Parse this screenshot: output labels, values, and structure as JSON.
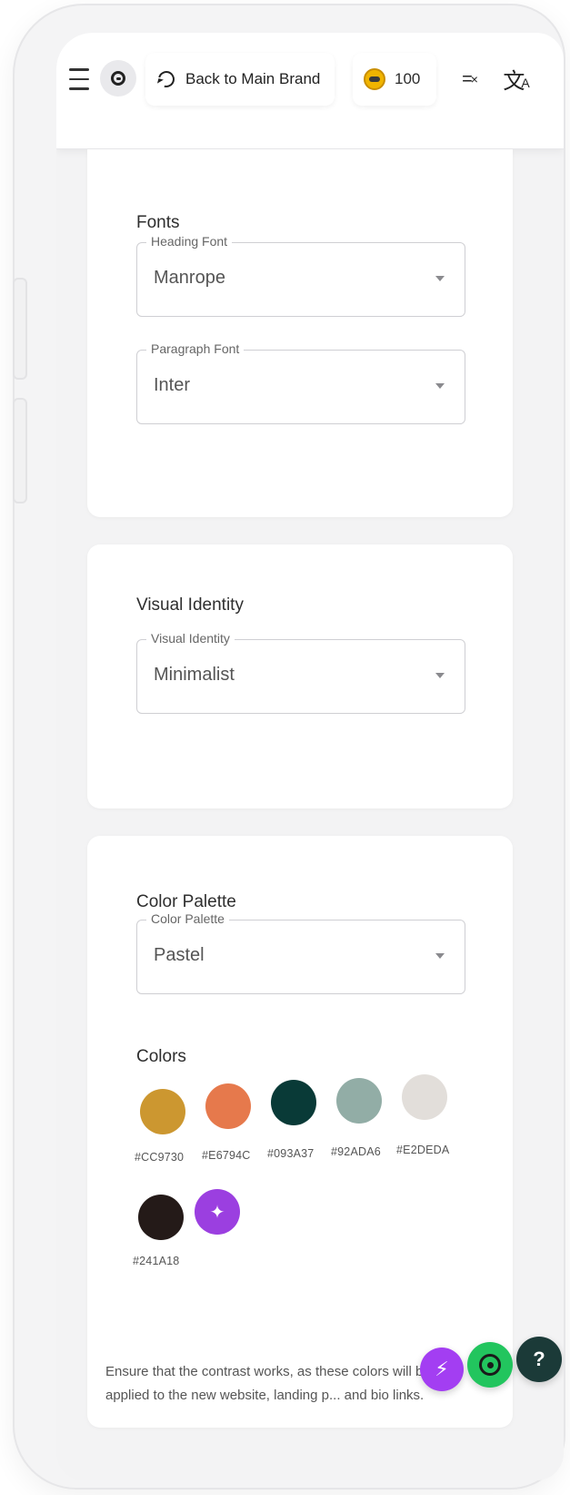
{
  "header": {
    "back_label": "Back to Main Brand",
    "credits": "100"
  },
  "icons": {
    "menu": "hamburger-icon",
    "account": "account-icon",
    "back": "history-back-icon",
    "credits": "coin-icon",
    "sort": "sort-icon",
    "translate": "translate-icon"
  },
  "fonts_section": {
    "title": "Fonts",
    "heading_font": {
      "label": "Heading Font",
      "value": "Manrope"
    },
    "paragraph_font": {
      "label": "Paragraph Font",
      "value": "Inter"
    }
  },
  "visual_section": {
    "title": "Visual Identity",
    "field": {
      "label": "Visual Identity",
      "value": "Minimalist"
    }
  },
  "palette_section": {
    "title": "Color Palette",
    "field": {
      "label": "Color Palette",
      "value": "Pastel"
    },
    "colors_title": "Colors",
    "colors": [
      {
        "hex": "#CC9730",
        "color": "#CC9730"
      },
      {
        "hex": "#E6794C",
        "color": "#E6794C"
      },
      {
        "hex": "#093A37",
        "color": "#093A37"
      },
      {
        "hex": "#92ADA6",
        "color": "#92ADA6"
      },
      {
        "hex": "#E2DEDA",
        "color": "#E2DEDA"
      },
      {
        "hex": "#241A18",
        "color": "#241A18"
      }
    ],
    "magic_icon": "sparkles-icon",
    "note": "Ensure that the contrast works, as these colors will be applied to the new website, landing p... and bio links."
  },
  "floating": {
    "bolt_icon": "bolt-icon",
    "whatsapp_icon": "whatsapp-icon",
    "help_label": "?"
  }
}
